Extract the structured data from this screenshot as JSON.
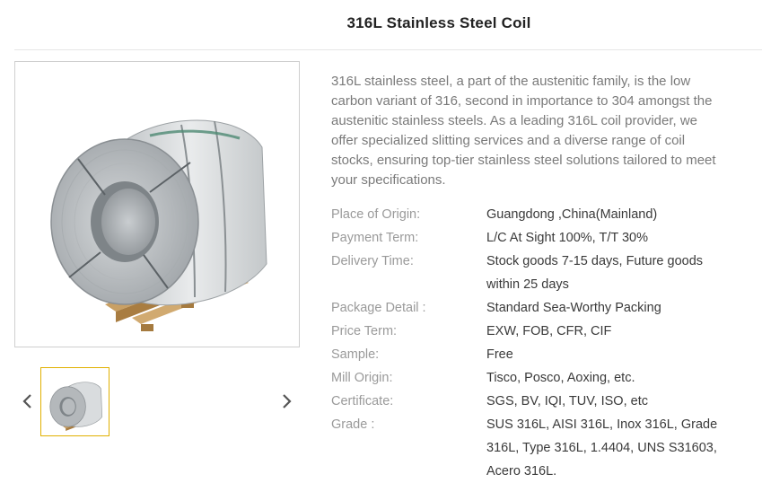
{
  "product": {
    "title": "316L Stainless Steel Coil",
    "description": "316L stainless steel, a part of the austenitic family, is the low carbon variant of 316, second in importance to 304 amongst the austenitic stainless steels. As a leading 316L coil provider, we offer specialized slitting services and a diverse range of coil stocks, ensuring top-tier stainless steel solutions tailored to meet your specifications."
  },
  "gallery": {
    "prev_icon": "chevron-left-icon",
    "next_icon": "chevron-right-icon",
    "arrow_color": "#555555",
    "thumb_border_color": "#e0b000"
  },
  "specs": [
    {
      "label": "Place of Origin:",
      "value": "Guangdong ,China(Mainland)"
    },
    {
      "label": "Payment Term:",
      "value": "L/C At Sight 100%, T/T 30%"
    },
    {
      "label": "Delivery Time:",
      "value": "Stock goods 7-15 days, Future goods within 25 days"
    },
    {
      "label": "Package Detail :",
      "value": "Standard Sea-Worthy Packing"
    },
    {
      "label": "Price Term:",
      "value": "EXW, FOB, CFR, CIF"
    },
    {
      "label": "Sample:",
      "value": "Free"
    },
    {
      "label": "Mill Origin:",
      "value": "Tisco, Posco, Aoxing, etc."
    },
    {
      "label": "Certificate:",
      "value": "SGS, BV, IQI, TUV, ISO, etc"
    },
    {
      "label": "Grade :",
      "value": "SUS 316L, AISI 316L, Inox 316L, Grade 316L, Type 316L, 1.4404, UNS S31603, Acero 316L."
    }
  ]
}
